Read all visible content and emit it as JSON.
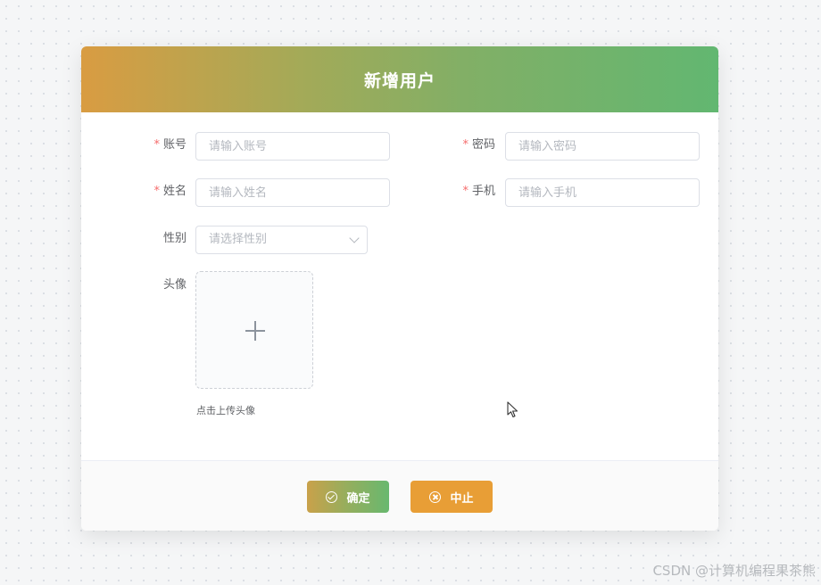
{
  "dialog": {
    "title": "新增用户",
    "fields": {
      "account": {
        "label": "账号",
        "required": "*",
        "placeholder": "请输入账号",
        "value": ""
      },
      "password": {
        "label": "密码",
        "required": "*",
        "placeholder": "请输入密码",
        "value": ""
      },
      "name": {
        "label": "姓名",
        "required": "*",
        "placeholder": "请输入姓名",
        "value": ""
      },
      "phone": {
        "label": "手机",
        "required": "*",
        "placeholder": "请输入手机",
        "value": ""
      },
      "gender": {
        "label": "性别",
        "placeholder": "请选择性别"
      },
      "avatar": {
        "label": "头像",
        "tip": "点击上传头像"
      }
    },
    "buttons": {
      "confirm": "确定",
      "abort": "中止"
    }
  },
  "watermark": "CSDN @计算机编程果茶熊",
  "colors": {
    "header_start": "#d99c42",
    "header_end": "#62b771",
    "required_star": "#f56c6c",
    "abort_button": "#e89e36"
  },
  "icons": [
    "plus-icon",
    "check-circle-icon",
    "close-circle-icon",
    "chevron-down-icon",
    "mouse-pointer-icon"
  ]
}
